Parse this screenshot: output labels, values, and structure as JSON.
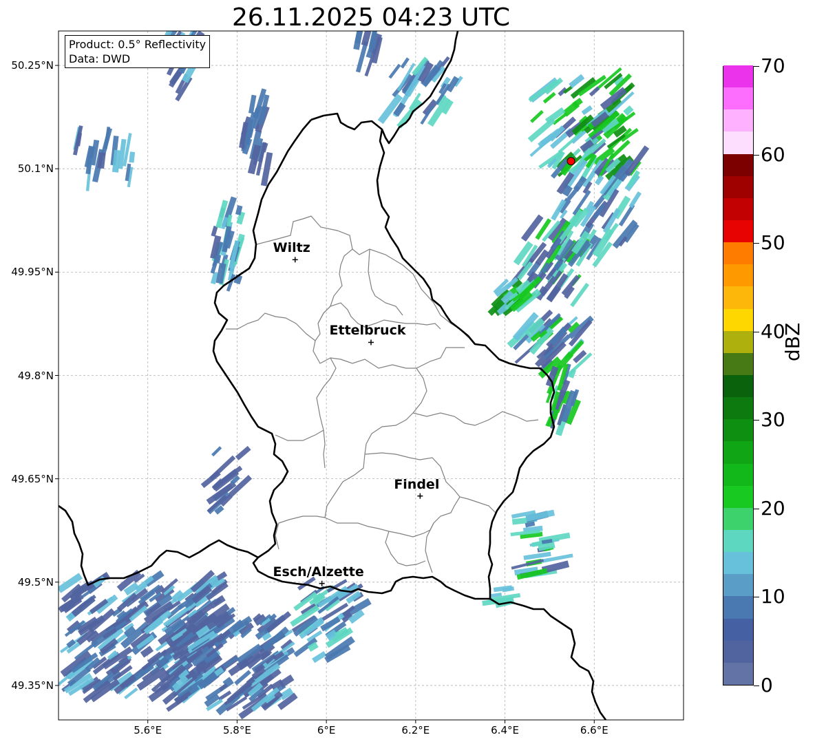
{
  "title": "26.11.2025 04:23 UTC",
  "info": {
    "product": "Product: 0.5° Reflectivity",
    "data": "Data: DWD"
  },
  "axes": {
    "x_ticks": [
      {
        "value": 5.6,
        "label": "5.6°E"
      },
      {
        "value": 5.8,
        "label": "5.8°E"
      },
      {
        "value": 6.0,
        "label": "6°E"
      },
      {
        "value": 6.2,
        "label": "6.2°E"
      },
      {
        "value": 6.4,
        "label": "6.4°E"
      },
      {
        "value": 6.6,
        "label": "6.6°E"
      }
    ],
    "y_ticks": [
      {
        "value": 50.25,
        "label": "50.25°N"
      },
      {
        "value": 50.1,
        "label": "50.1°N"
      },
      {
        "value": 49.95,
        "label": "49.95°N"
      },
      {
        "value": 49.8,
        "label": "49.8°N"
      },
      {
        "value": 49.65,
        "label": "49.65°N"
      },
      {
        "value": 49.5,
        "label": "49.5°N"
      },
      {
        "value": 49.35,
        "label": "49.35°N"
      }
    ],
    "lon_range": [
      5.4,
      6.8
    ],
    "lat_range": [
      49.3,
      50.3
    ],
    "grid": true
  },
  "cities": [
    {
      "name": "Wiltz",
      "lon": 5.93,
      "lat": 49.968
    },
    {
      "name": "Ettelbruck",
      "lon": 6.1,
      "lat": 49.848
    },
    {
      "name": "Findel",
      "lon": 6.21,
      "lat": 49.625
    },
    {
      "name": "Esch/Alzette",
      "lon": 5.99,
      "lat": 49.498
    }
  ],
  "radar_site": {
    "lon": 6.548,
    "lat": 50.111,
    "color": "#ff0000"
  },
  "colorbar": {
    "unit": "dBZ",
    "min": 0,
    "max": 70,
    "tick_values": [
      0,
      10,
      20,
      30,
      40,
      50,
      60,
      70
    ],
    "tick_labels": [
      "0",
      "10",
      "20",
      "30",
      "40",
      "50",
      "60",
      "70"
    ],
    "colors": [
      "#6473a6",
      "#52649f",
      "#4560a3",
      "#4a78b0",
      "#5a9ec7",
      "#67c1db",
      "#5ed7c1",
      "#3ed26d",
      "#17c920",
      "#12b81a",
      "#10a514",
      "#0e8f12",
      "#0c7a0f",
      "#0a630c",
      "#477a14",
      "#aeb10d",
      "#fed700",
      "#fdb70a",
      "#fe9900",
      "#fe7d00",
      "#e80303",
      "#c20202",
      "#9f0000",
      "#7c0000",
      "#fedefe",
      "#feb1fe",
      "#fe6efe",
      "#ea33ea"
    ]
  },
  "echo_colors": {
    "weak": "#52649f",
    "light": "#4a78b0",
    "cyan": "#5ed7c1",
    "sky": "#67c1db",
    "green": "#17c920",
    "dark_green": "#0e8f12",
    "border_line": "#000000",
    "canton_line": "#808080"
  }
}
